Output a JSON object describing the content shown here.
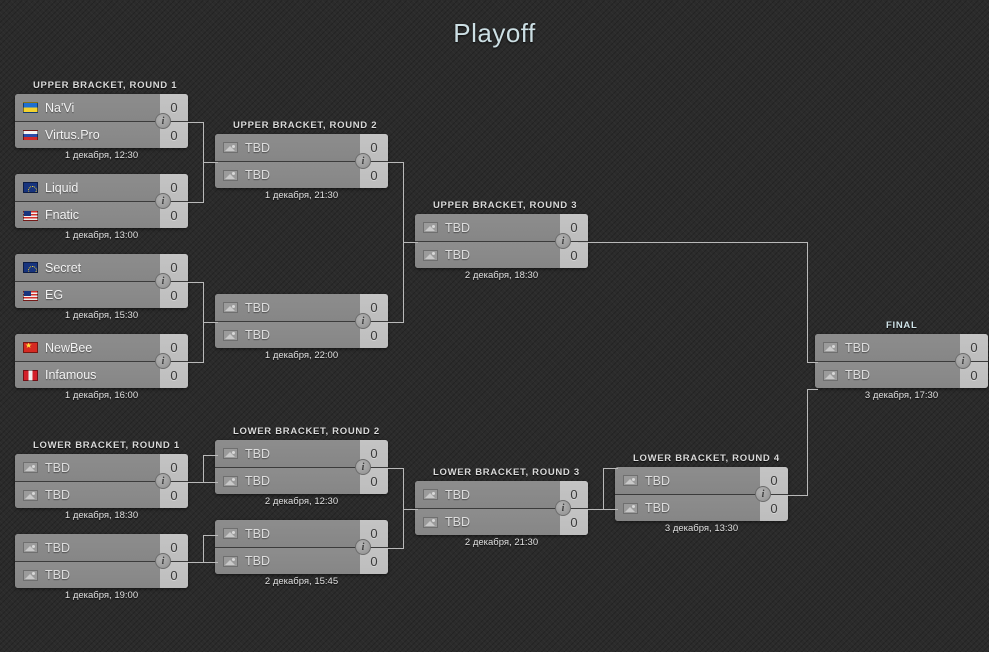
{
  "page": {
    "title": "Playoff",
    "accent_color": "#ccdfe4",
    "background_color": "#2b2b2b",
    "connector_color": "#b9b9b9",
    "box_color": "#8e8e8e",
    "score_bg_color": "#c4c4c4"
  },
  "rounds": [
    {
      "id": "ub-r1",
      "label": "UPPER BRACKET, ROUND 1"
    },
    {
      "id": "ub-r2",
      "label": "UPPER BRACKET, ROUND 2"
    },
    {
      "id": "ub-r3",
      "label": "UPPER BRACKET, ROUND 3"
    },
    {
      "id": "final",
      "label": "FINAL"
    },
    {
      "id": "lb-r1",
      "label": "LOWER BRACKET, ROUND 1"
    },
    {
      "id": "lb-r2",
      "label": "LOWER BRACKET, ROUND 2"
    },
    {
      "id": "lb-r3",
      "label": "LOWER BRACKET, ROUND 3"
    },
    {
      "id": "lb-r4",
      "label": "LOWER BRACKET, ROUND 4"
    }
  ],
  "info_icon": "i",
  "matches": {
    "ub_r1_m1": {
      "top": {
        "team": "Na'Vi",
        "flag": "ua",
        "score": "0"
      },
      "bottom": {
        "team": "Virtus.Pro",
        "flag": "ru",
        "score": "0"
      },
      "time": "1 декабря, 12:30"
    },
    "ub_r1_m2": {
      "top": {
        "team": "Liquid",
        "flag": "eu",
        "score": "0"
      },
      "bottom": {
        "team": "Fnatic",
        "flag": "us",
        "score": "0"
      },
      "time": "1 декабря, 13:00"
    },
    "ub_r1_m3": {
      "top": {
        "team": "Secret",
        "flag": "eu",
        "score": "0"
      },
      "bottom": {
        "team": "EG",
        "flag": "us",
        "score": "0"
      },
      "time": "1 декабря, 15:30"
    },
    "ub_r1_m4": {
      "top": {
        "team": "NewBee",
        "flag": "cn",
        "score": "0"
      },
      "bottom": {
        "team": "Infamous",
        "flag": "pe",
        "score": "0"
      },
      "time": "1 декабря, 16:00"
    },
    "ub_r2_m1": {
      "top": {
        "team": "TBD",
        "flag": "tbd",
        "score": "0"
      },
      "bottom": {
        "team": "TBD",
        "flag": "tbd",
        "score": "0"
      },
      "time": "1 декабря, 21:30"
    },
    "ub_r2_m2": {
      "top": {
        "team": "TBD",
        "flag": "tbd",
        "score": "0"
      },
      "bottom": {
        "team": "TBD",
        "flag": "tbd",
        "score": "0"
      },
      "time": "1 декабря, 22:00"
    },
    "ub_r3_m1": {
      "top": {
        "team": "TBD",
        "flag": "tbd",
        "score": "0"
      },
      "bottom": {
        "team": "TBD",
        "flag": "tbd",
        "score": "0"
      },
      "time": "2 декабря, 18:30"
    },
    "final_m1": {
      "top": {
        "team": "TBD",
        "flag": "tbd",
        "score": "0"
      },
      "bottom": {
        "team": "TBD",
        "flag": "tbd",
        "score": "0"
      },
      "time": "3 декабря, 17:30"
    },
    "lb_r1_m1": {
      "top": {
        "team": "TBD",
        "flag": "tbd",
        "score": "0"
      },
      "bottom": {
        "team": "TBD",
        "flag": "tbd",
        "score": "0"
      },
      "time": "1 декабря, 18:30"
    },
    "lb_r1_m2": {
      "top": {
        "team": "TBD",
        "flag": "tbd",
        "score": "0"
      },
      "bottom": {
        "team": "TBD",
        "flag": "tbd",
        "score": "0"
      },
      "time": "1 декабря, 19:00"
    },
    "lb_r2_m1": {
      "top": {
        "team": "TBD",
        "flag": "tbd",
        "score": "0"
      },
      "bottom": {
        "team": "TBD",
        "flag": "tbd",
        "score": "0"
      },
      "time": "2 декабря, 12:30"
    },
    "lb_r2_m2": {
      "top": {
        "team": "TBD",
        "flag": "tbd",
        "score": "0"
      },
      "bottom": {
        "team": "TBD",
        "flag": "tbd",
        "score": "0"
      },
      "time": "2 декабря, 15:45"
    },
    "lb_r3_m1": {
      "top": {
        "team": "TBD",
        "flag": "tbd",
        "score": "0"
      },
      "bottom": {
        "team": "TBD",
        "flag": "tbd",
        "score": "0"
      },
      "time": "2 декабря, 21:30"
    },
    "lb_r4_m1": {
      "top": {
        "team": "TBD",
        "flag": "tbd",
        "score": "0"
      },
      "bottom": {
        "team": "TBD",
        "flag": "tbd",
        "score": "0"
      },
      "time": "3 декабря, 13:30"
    }
  }
}
